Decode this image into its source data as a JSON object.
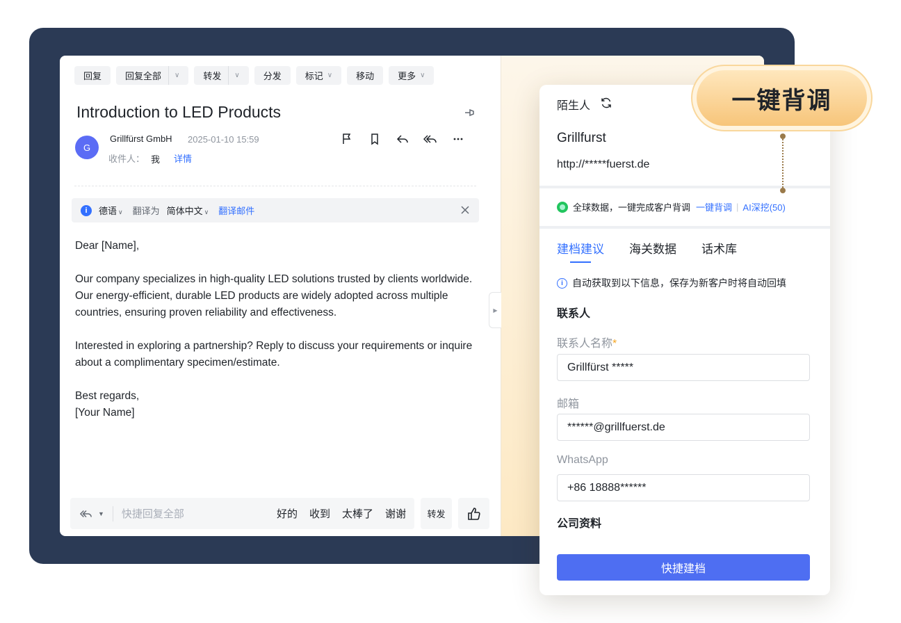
{
  "toolbar": {
    "reply": "回复",
    "reply_all": "回复全部",
    "forward": "转发",
    "distribute": "分发",
    "mark": "标记",
    "move": "移动",
    "more": "更多"
  },
  "email": {
    "subject": "Introduction to LED Products",
    "avatar_initial": "G",
    "sender": "Grillfürst GmbH",
    "date": "2025-01-10 15:59",
    "recipient_label": "收件人：",
    "recipient": "我",
    "details_link": "详情",
    "body": [
      "Dear [Name],",
      "Our company specializes in high-quality LED solutions trusted by clients worldwide. Our energy-efficient, durable LED products are widely adopted across multiple countries, ensuring proven reliability and effectiveness.",
      "Interested in exploring a partnership? Reply to discuss your requirements or inquire about a complimentary specimen/estimate.",
      "Best regards,\n[Your Name]"
    ]
  },
  "translate": {
    "info_glyph": "i",
    "source_lang": "德语",
    "translate_to": "翻译为",
    "target_lang": "简体中文",
    "action": "翻译邮件"
  },
  "reply_bar": {
    "placeholder": "快捷回复全部",
    "quick_replies": [
      "好的",
      "收到",
      "太棒了",
      "谢谢"
    ],
    "forward": "转发"
  },
  "card": {
    "stranger": "陌生人",
    "company": "Grillfurst",
    "url": "http://*****fuerst.de",
    "global_text": "全球数据，一键完成客户背调",
    "global_link1": "一键背调",
    "global_sep": "|",
    "global_link2": "AI深挖(50)",
    "tabs": [
      "建档建议",
      "海关数据",
      "话术库"
    ],
    "auto_info_glyph": "i",
    "auto_info": "自动获取到以下信息，保存为新客户时将自动回填",
    "contact_section": "联系人",
    "contact_name_label": "联系人名称",
    "required_mark": "*",
    "contact_name": "Grillfürst *****",
    "email_label": "邮箱",
    "email": "******@grillfuerst.de",
    "whatsapp_label": "WhatsApp",
    "whatsapp": "+86 18888******",
    "company_section": "公司资料",
    "save_button": "快捷建档"
  },
  "badge": {
    "label": "一键背调"
  },
  "colors": {
    "frame": "#2b3a55",
    "accent_blue": "#3370ff",
    "save_button": "#4e6ef2",
    "badge_gold": "#f7c57a",
    "required": "#f5a623"
  },
  "icons": {
    "pin": "pin-icon",
    "flag": "flag-icon",
    "bookmark": "bookmark-icon",
    "reply": "reply-icon",
    "reply_all": "reply-all-icon",
    "more": "more-icon",
    "close": "close-icon",
    "refresh": "refresh-icon",
    "like": "thumbs-up-icon"
  }
}
